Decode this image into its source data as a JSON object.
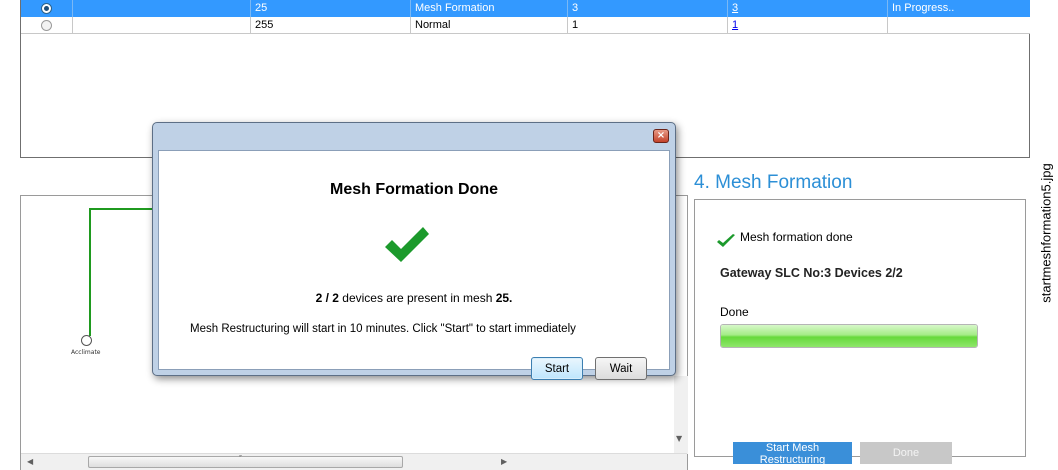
{
  "table": {
    "rows": [
      {
        "selected": true,
        "col1": "",
        "mesh": "25",
        "status": "Mesh Formation",
        "count": "3",
        "link": "3",
        "state": "In Progress.."
      },
      {
        "selected": false,
        "col1": "",
        "mesh": "255",
        "status": "Normal",
        "count": "1",
        "link": "1",
        "state": ""
      }
    ]
  },
  "diagram": {
    "node_label": "Acclimate",
    "hscroll_grip": "″"
  },
  "step_panel": {
    "title": "4. Mesh Formation",
    "status_text": "Mesh formation done",
    "gateway_label": "Gateway SLC No:3  Devices 2/2",
    "progress_label": "Done",
    "progress": 1.0,
    "restructure_button": "Start Mesh Restructuring",
    "done_button": "Done"
  },
  "dialog": {
    "title": "Mesh Formation Done",
    "close_icon": "×",
    "devices_count": "2 / 2",
    "devices_text": " devices are present in mesh ",
    "mesh_id": "25.",
    "info": "Mesh Restructuring will start in 10 minutes.  Click \"Start\" to start immediately",
    "start_button": "Start",
    "wait_button": "Wait"
  },
  "filename": "startmeshformation5.jpg",
  "colors": {
    "selection": "#3399ff",
    "accent_title": "#2c8fd6",
    "check_green": "#1c9a2c",
    "button_blue": "#3a8fd9"
  }
}
